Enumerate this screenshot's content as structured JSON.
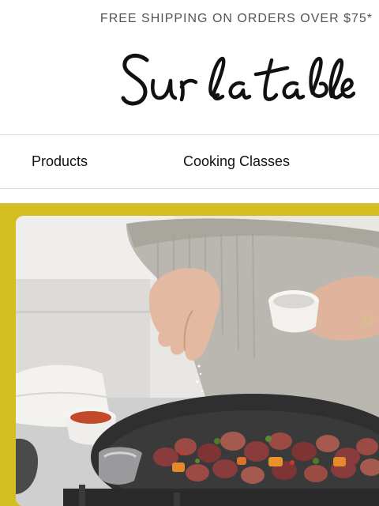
{
  "promo": {
    "text": "FREE SHIPPING ON ORDERS OVER $75*"
  },
  "brand": {
    "logo_text": "Sur la table"
  },
  "nav": {
    "items": [
      {
        "label": "Products"
      },
      {
        "label": "Cooking Classes"
      }
    ]
  },
  "hero": {
    "accent_color": "#d4bf22"
  }
}
